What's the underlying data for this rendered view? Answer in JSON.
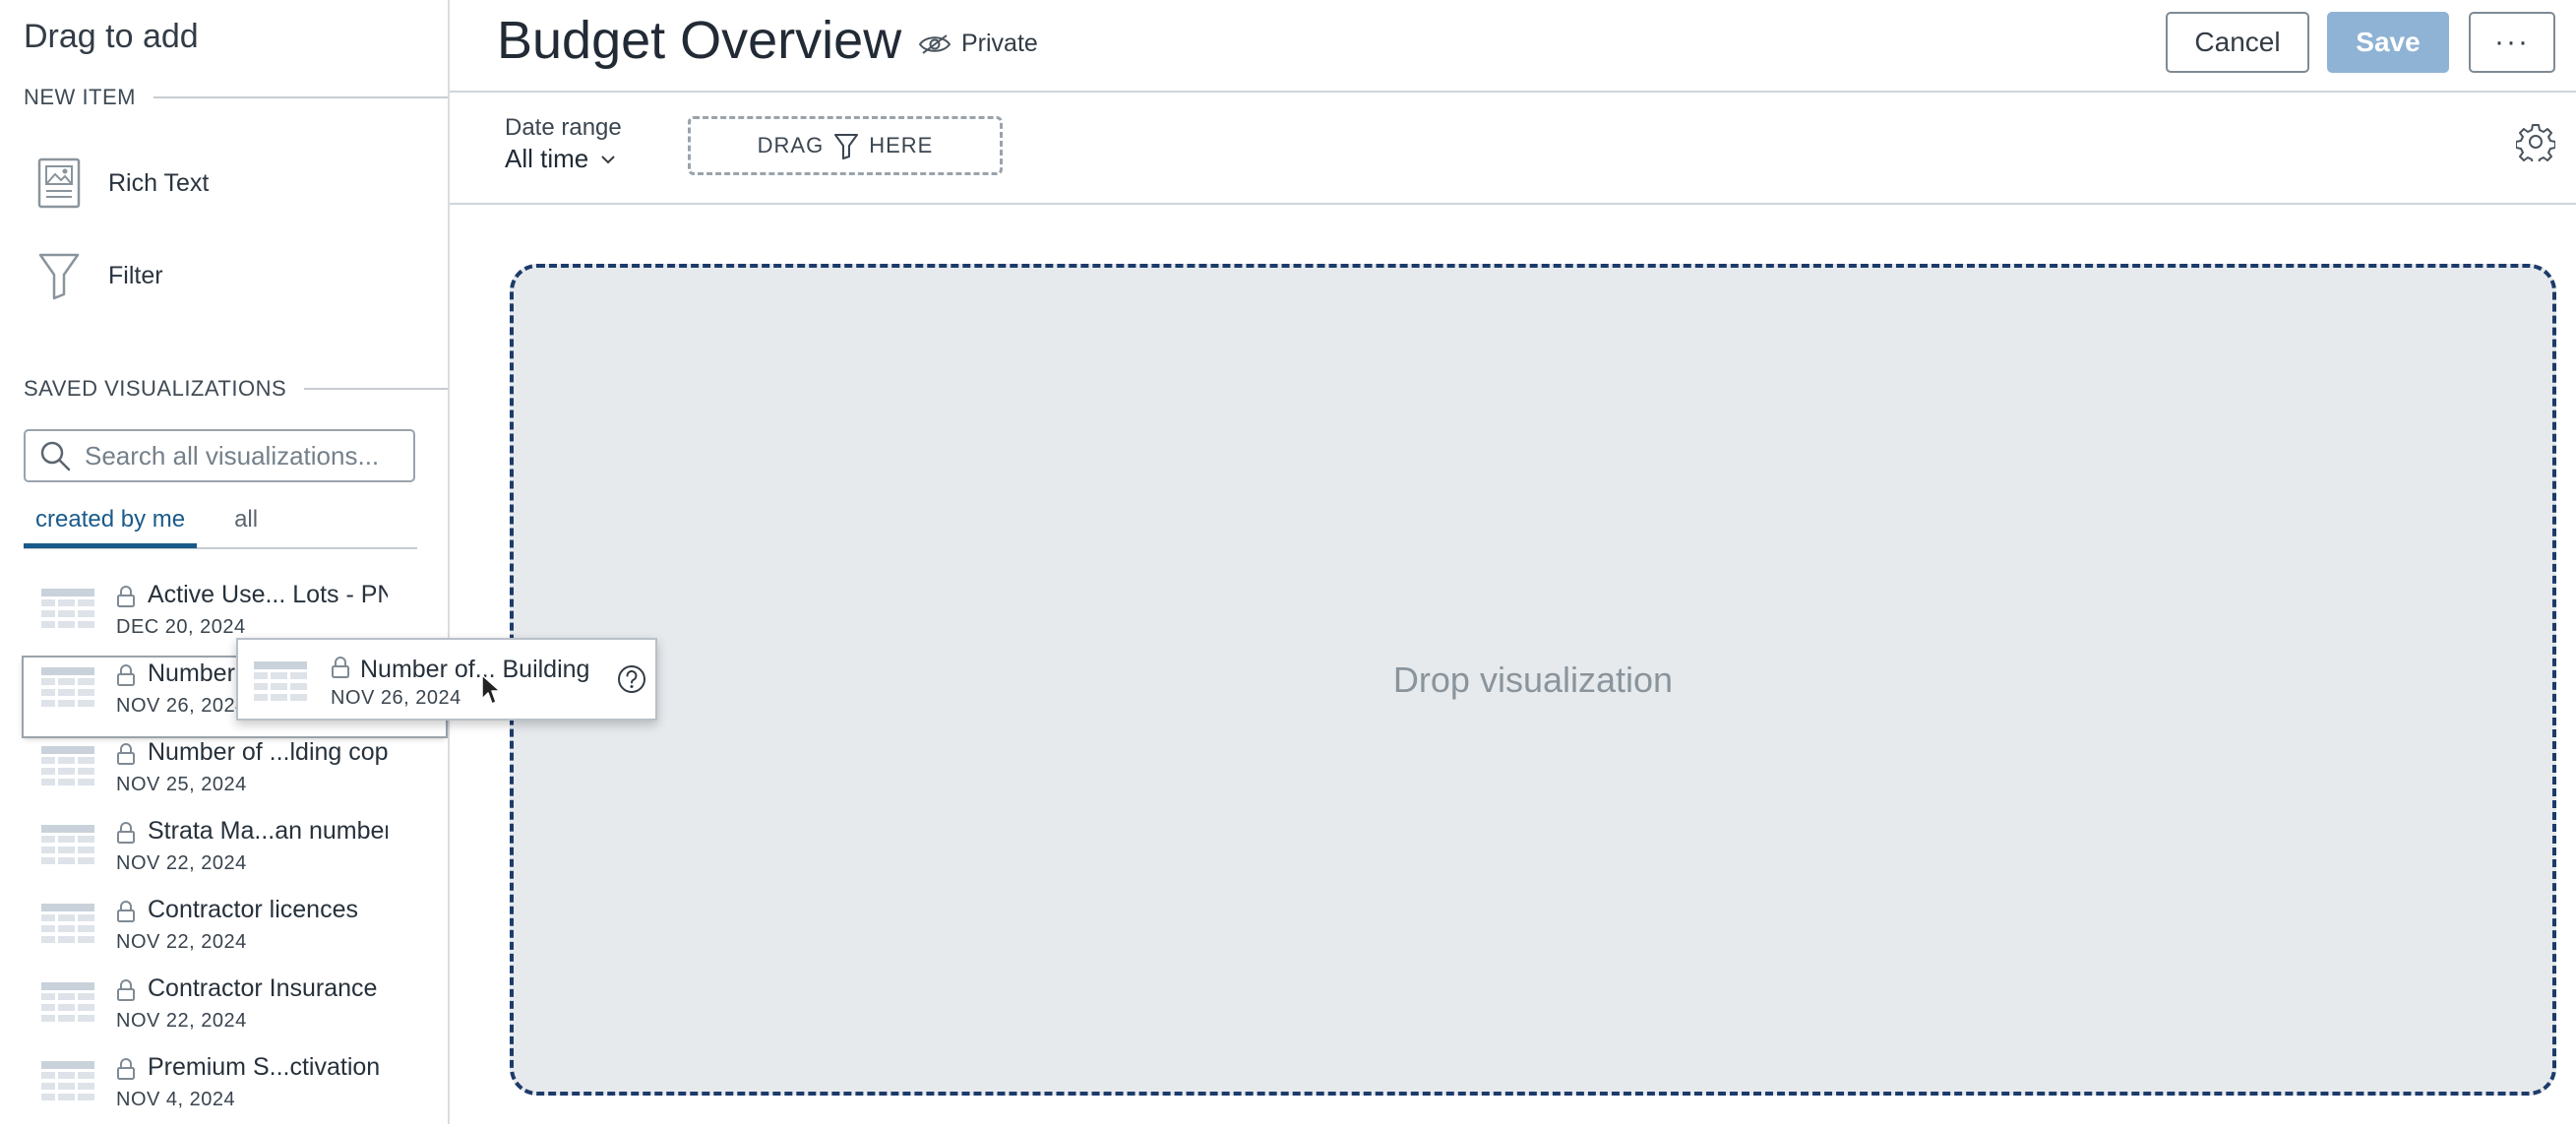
{
  "sidebar": {
    "title": "Drag to add",
    "new_item_header": "NEW ITEM",
    "new_items": [
      {
        "label": "Rich Text",
        "icon": "image-document-icon"
      },
      {
        "label": "Filter",
        "icon": "funnel-icon"
      }
    ],
    "saved_header": "SAVED VISUALIZATIONS",
    "search_placeholder": "Search all visualizations...",
    "tabs": [
      {
        "label": "created by me",
        "active": true
      },
      {
        "label": "all",
        "active": false
      }
    ],
    "visualizations": [
      {
        "name": "Active Use... Lots - PN",
        "date": "DEC 20, 2024"
      },
      {
        "name": "Number of... Building",
        "date": "NOV 26, 2024"
      },
      {
        "name": "Number of ...lding cop",
        "date": "NOV 25, 2024"
      },
      {
        "name": "Strata Ma...an number",
        "date": "NOV 22, 2024"
      },
      {
        "name": "Contractor licences",
        "date": "NOV 22, 2024"
      },
      {
        "name": "Contractor Insurance",
        "date": "NOV 22, 2024"
      },
      {
        "name": "Premium S...ctivation",
        "date": "NOV 4, 2024"
      }
    ]
  },
  "header": {
    "title": "Budget Overview",
    "privacy": "Private",
    "cancel_label": "Cancel",
    "save_label": "Save",
    "more_label": "···"
  },
  "filters": {
    "date_label": "Date range",
    "date_value": "All time",
    "drag_before": "DRAG",
    "drag_after": "HERE"
  },
  "canvas": {
    "drop_text": "Drop visualization"
  },
  "drag_ghost": {
    "name": "Number of... Building",
    "date": "NOV 26, 2024"
  },
  "colors": {
    "accent": "#1a5a8a",
    "save_disabled": "#8fb3d4",
    "drop_border": "#1d3b6a",
    "drop_bg": "#e6eaed"
  }
}
